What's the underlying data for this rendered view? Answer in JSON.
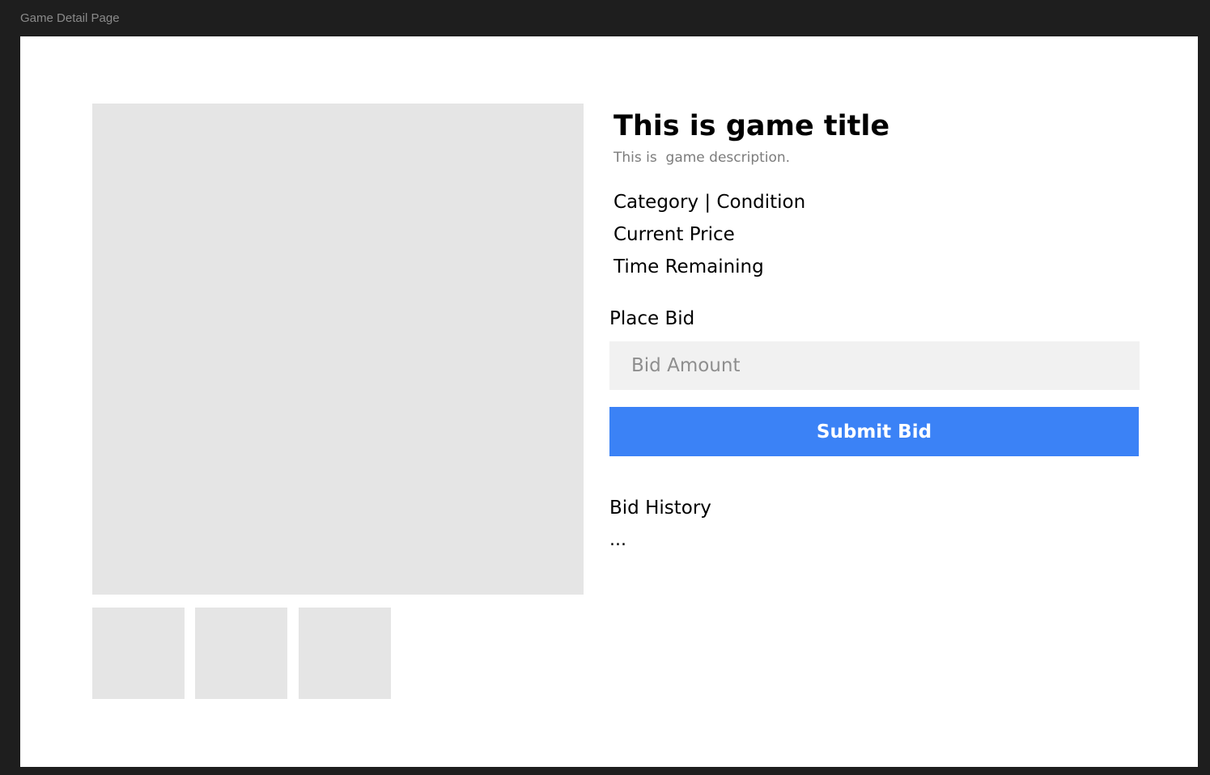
{
  "frame": {
    "label": "Game Detail Page"
  },
  "game": {
    "title": "This is game title",
    "description": "This is  game description.",
    "category_condition": "Category | Condition",
    "current_price": "Current Price",
    "time_remaining": "Time Remaining"
  },
  "bid": {
    "heading": "Place Bid",
    "input_placeholder": "Bid Amount",
    "input_value": "",
    "submit_label": "Submit Bid",
    "button_color": "#3b82f6"
  },
  "history": {
    "heading": "Bid History",
    "content": "..."
  }
}
